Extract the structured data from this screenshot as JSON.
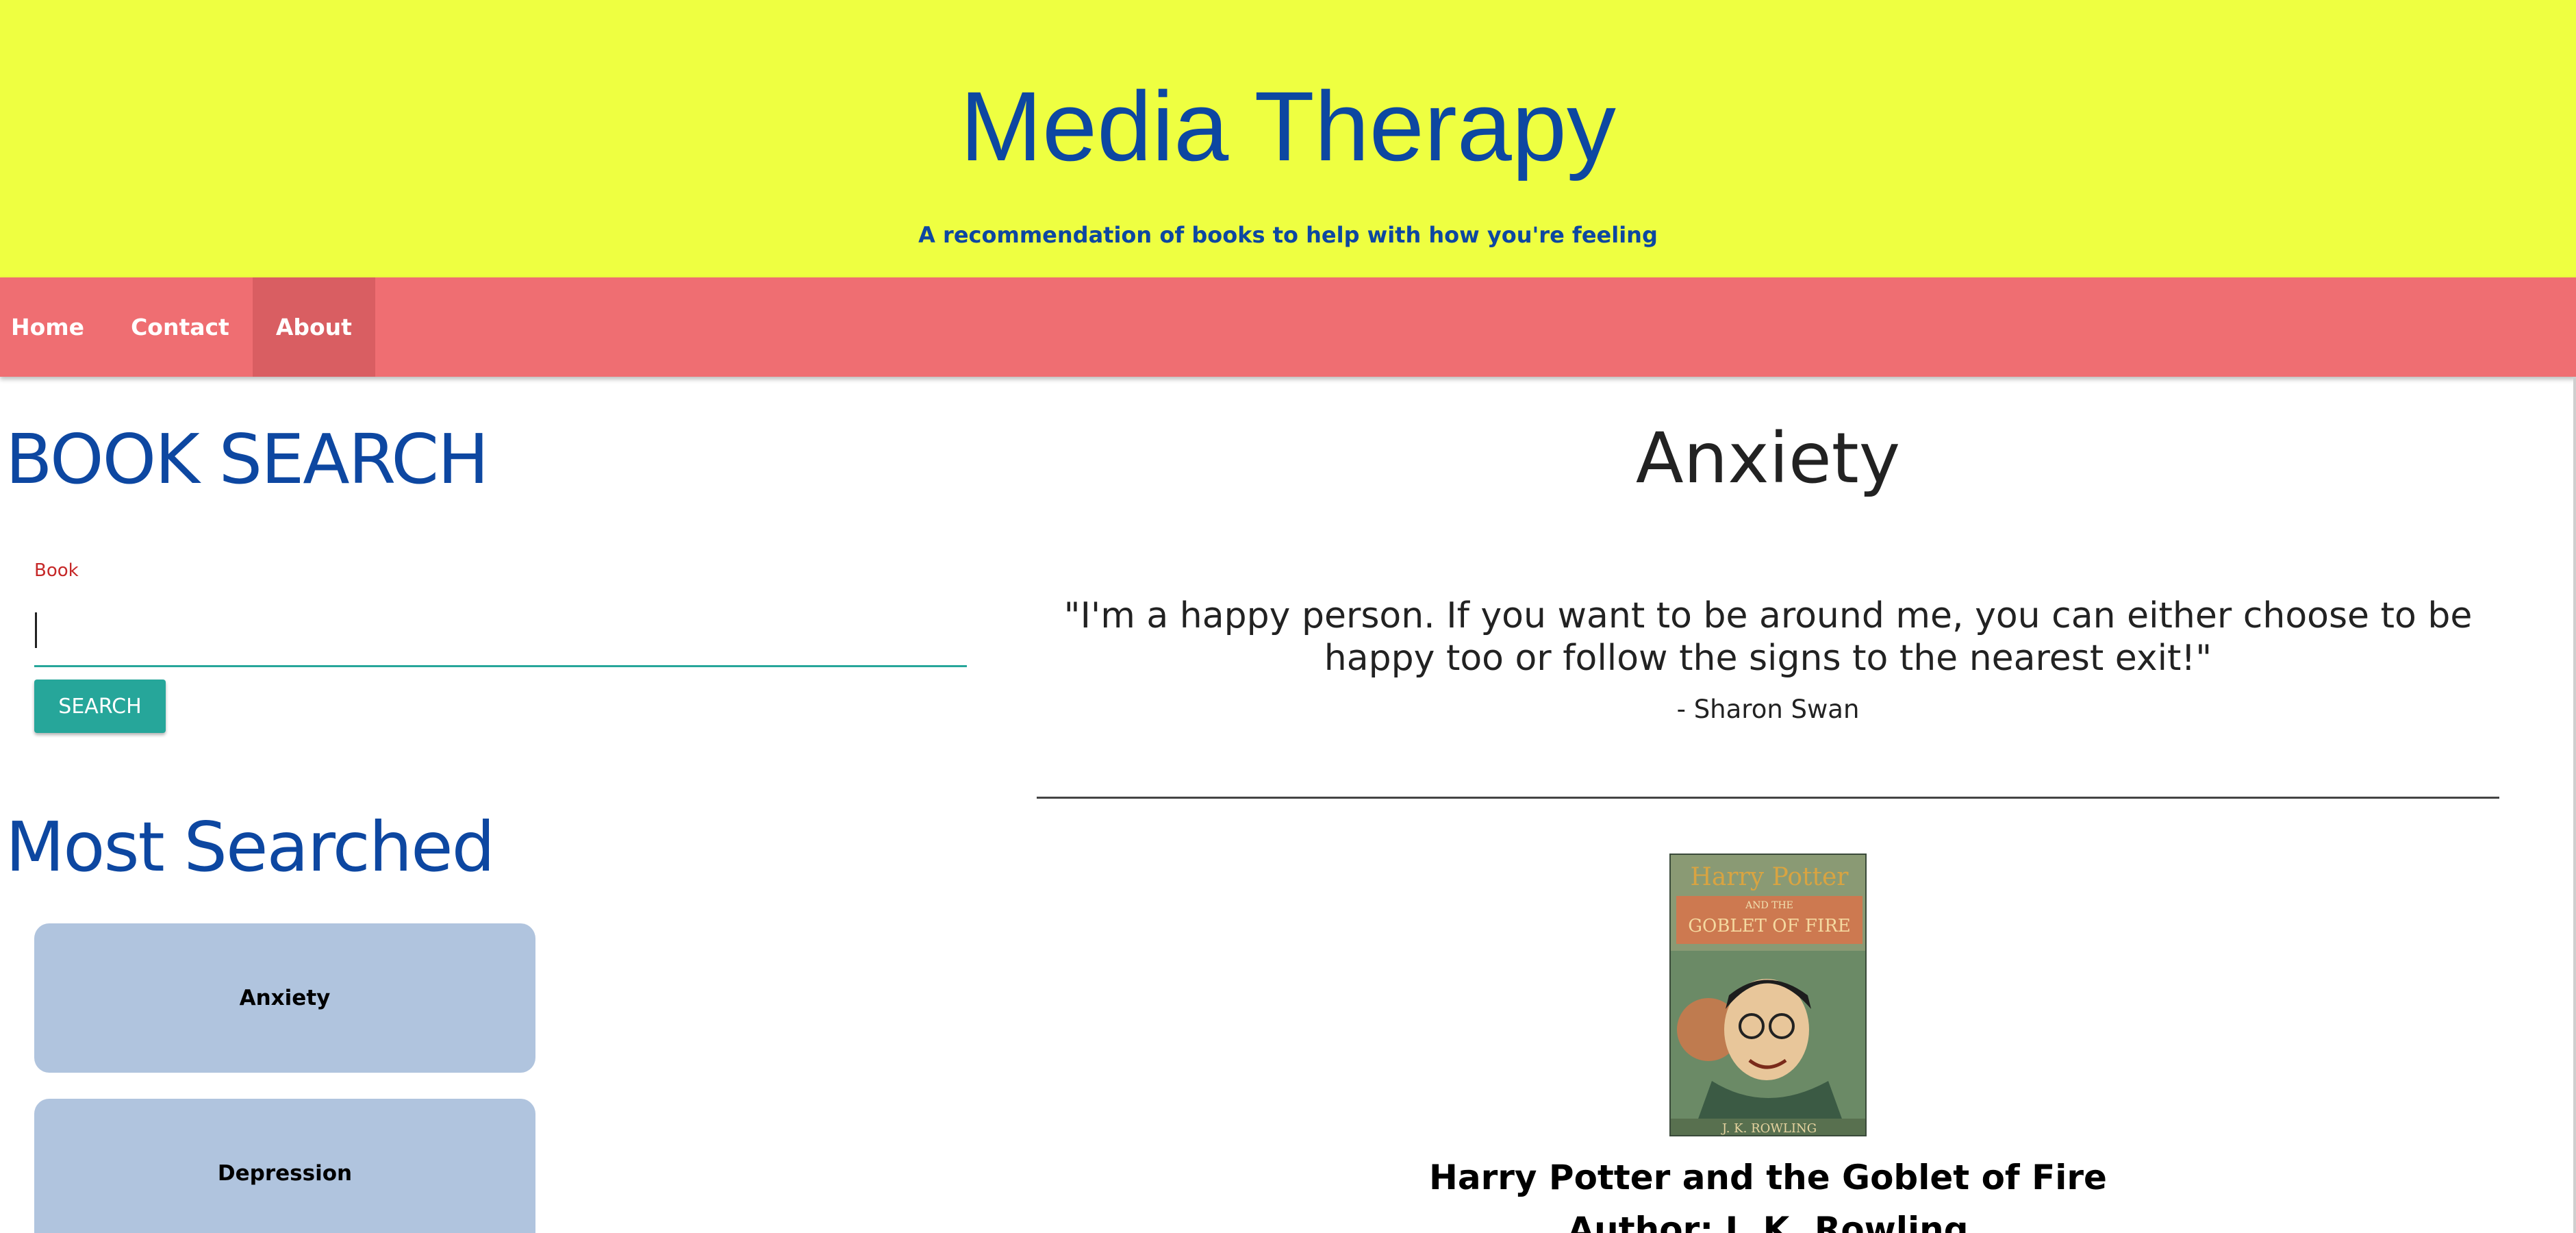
{
  "header": {
    "title": "Media Therapy",
    "subtitle": "A recommendation of books to help with how you're feeling"
  },
  "nav": {
    "items": [
      {
        "label": "Home"
      },
      {
        "label": "Contact"
      },
      {
        "label": "About"
      }
    ],
    "active": "About"
  },
  "search": {
    "heading": "BOOK SEARCH",
    "label": "Book",
    "value": "",
    "button_label": "SEARCH"
  },
  "most_searched": {
    "heading": "Most Searched",
    "items": [
      {
        "label": "Anxiety"
      },
      {
        "label": "Depression"
      }
    ]
  },
  "main": {
    "mood": "Anxiety",
    "quote": "\"I'm a happy person. If you want to be around me, you can either choose to be happy too or follow the signs to the nearest exit!\"",
    "quote_author": "- Sharon Swan",
    "book": {
      "title": "Harry Potter and the Goblet of Fire",
      "author_line": "Author: J. K. Rowling",
      "cover_title_line1": "Harry Potter",
      "cover_title_line2": "AND THE",
      "cover_title_line3": "GOBLET OF FIRE",
      "cover_author": "J. K. ROWLING"
    }
  },
  "colors": {
    "header_bg": "#eeff41",
    "nav_bg": "#ef6e72",
    "brand_blue": "#0d47a1",
    "teal": "#26a69a",
    "card_bg": "#b0c4de"
  }
}
